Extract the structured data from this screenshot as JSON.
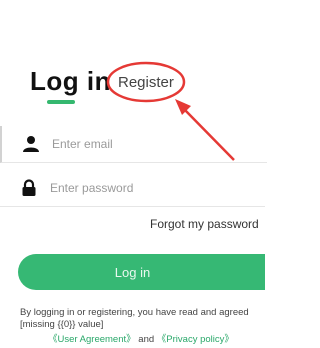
{
  "tabs": {
    "login_label": "Log in",
    "register_label": "Register"
  },
  "form": {
    "email_placeholder": "Enter email",
    "password_placeholder": "Enter password",
    "forgot_label": "Forgot my password"
  },
  "login_button": "Log in",
  "agreement": {
    "text": "By logging in or registering, you have read and agreed [missing {{0}} value]",
    "user_agreement": "《User Agreement》",
    "and": "and",
    "privacy_policy": "《Privacy policy》"
  },
  "colors": {
    "accent": "#36b874",
    "annotation": "#e53935"
  },
  "icons": [
    "person-icon",
    "lock-icon"
  ]
}
